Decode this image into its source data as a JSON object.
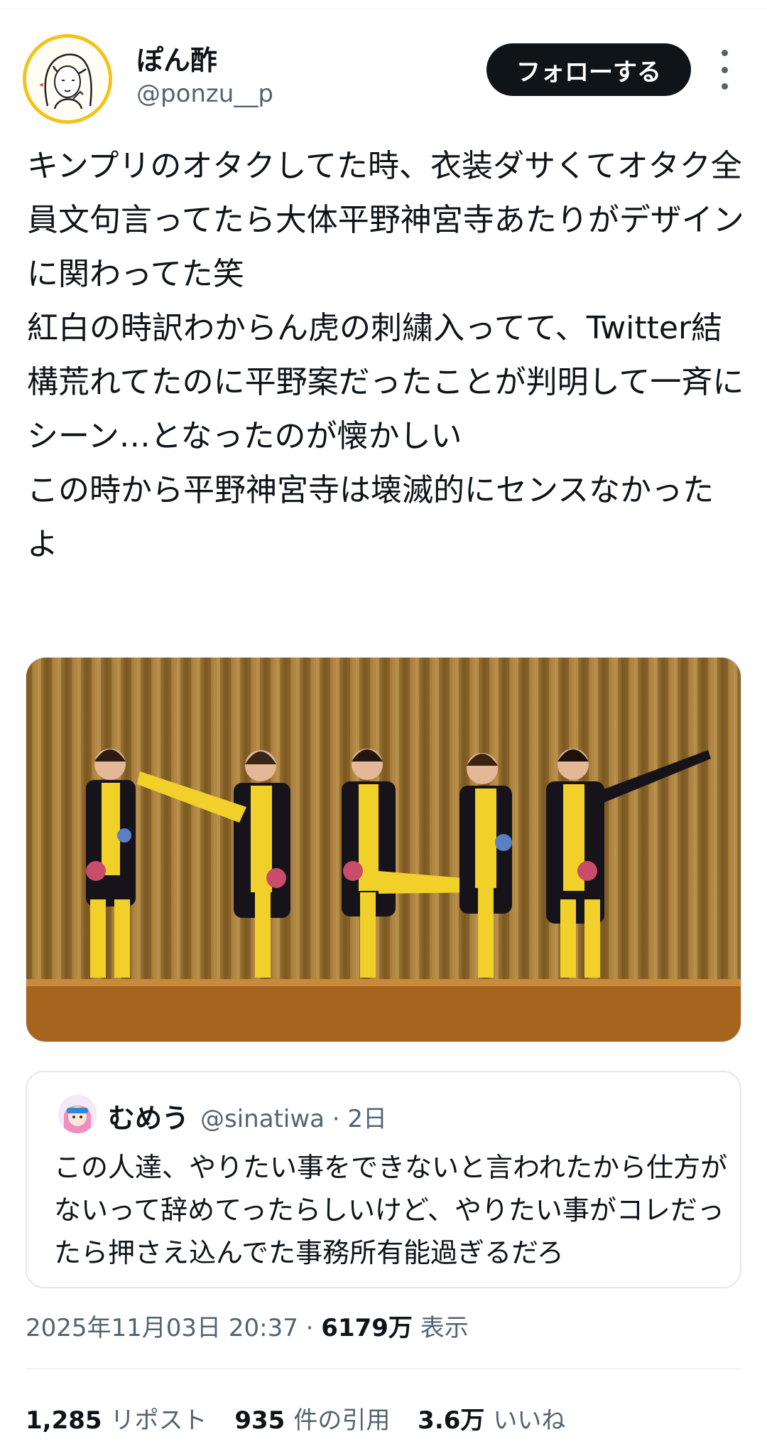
{
  "author": {
    "display_name": "ぽん酢",
    "handle": "@ponzu__p",
    "avatar_icon": "illustrated-girl-avatar",
    "avatar_border_color": "#f2c318"
  },
  "follow_button": {
    "label": "フォローする"
  },
  "more_menu": {
    "icon": "vertical-ellipsis-icon"
  },
  "tweet": {
    "text": "キンプリのオタクしてた時、衣装ダサくてオタク全員文句言ってたら大体平野神宮寺あたりがデザインに関わってた笑\n紅白の時訳わからん虎の刺繍入ってて、Twitter結構荒れてたのに平野案だったことが判明して一斉にシーン…となったのが懐かしい\nこの時から平野神宮寺は壊滅的にセンスなかったよ"
  },
  "media": {
    "icon": "photo-five-performers-yellow-suits"
  },
  "quote_tweet": {
    "display_name": "むめう",
    "handle": "@sinatiwa",
    "separator": " · ",
    "time": "2日",
    "avatar_icon": "anime-character-avatar",
    "text": "この人達、やりたい事をできないと言われたから仕方がないって辞めてったらしいけど、やりたい事がコレだったら押さえ込んでた事務所有能過ぎるだろ"
  },
  "meta": {
    "timestamp": "2025年11月03日 20:37",
    "separator": " · ",
    "views_count": "6179万",
    "views_label": " 表示"
  },
  "stats": {
    "reposts_count": "1,285",
    "reposts_label": "リポスト",
    "quotes_count": "935",
    "quotes_label": "件の引用",
    "likes_count": "3.6万",
    "likes_label": "いいね"
  }
}
